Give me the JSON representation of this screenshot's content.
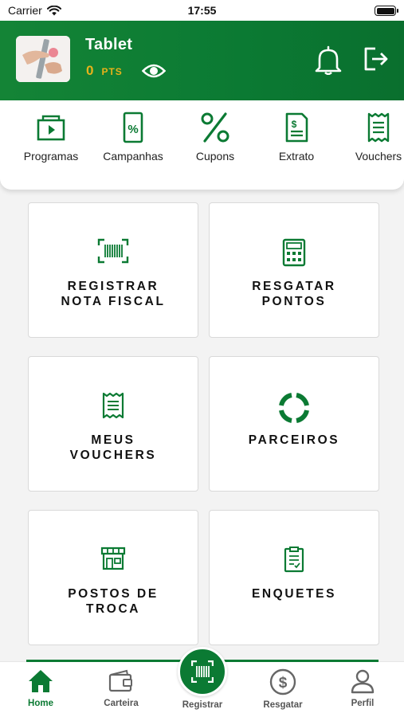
{
  "status_bar": {
    "carrier": "Carrier",
    "time": "17:55"
  },
  "header": {
    "user_name": "Tablet",
    "points_value": "0",
    "points_unit": "PTS"
  },
  "shortcuts": [
    {
      "label": "Programas",
      "icon": "programs-icon"
    },
    {
      "label": "Campanhas",
      "icon": "campaigns-icon"
    },
    {
      "label": "Cupons",
      "icon": "percent-icon"
    },
    {
      "label": "Extrato",
      "icon": "statement-icon"
    },
    {
      "label": "Vouchers",
      "icon": "voucher-icon"
    }
  ],
  "tiles": [
    {
      "line1": "REGISTRAR",
      "line2": "NOTA FISCAL",
      "icon": "barcode-scan-icon"
    },
    {
      "line1": "RESGATAR",
      "line2": "PONTOS",
      "icon": "calculator-icon"
    },
    {
      "line1": "MEUS",
      "line2": "VOUCHERS",
      "icon": "receipt-icon"
    },
    {
      "line1": "PARCEIROS",
      "line2": "",
      "icon": "partners-ring-icon"
    },
    {
      "line1": "POSTOS DE",
      "line2": "TROCA",
      "icon": "store-icon"
    },
    {
      "line1": "ENQUETES",
      "line2": "",
      "icon": "clipboard-icon"
    }
  ],
  "bottom_nav": {
    "home": "Home",
    "wallet": "Carteira",
    "register": "Registrar",
    "redeem": "Resgatar",
    "profile": "Perfil"
  },
  "colors": {
    "brand_green": "#0b7a33",
    "points_gold": "#e8b21a",
    "background": "#f3f3f3"
  }
}
